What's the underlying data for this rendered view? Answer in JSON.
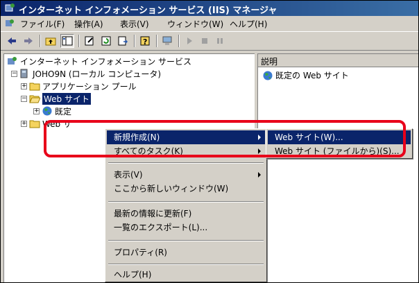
{
  "window": {
    "title": "インターネット インフォメーション サービス (IIS) マネージャ"
  },
  "menu": [
    "ファイル(F)",
    "操作(A)",
    "表示(V)",
    "ウィンドウ(W)",
    "ヘルプ(H)"
  ],
  "toolbar": {
    "icons": [
      "back-arrow-icon",
      "forward-arrow-icon",
      "up-folder-icon",
      "show-hide-tree-icon",
      "properties-icon",
      "refresh-icon",
      "export-list-icon",
      "help-icon",
      "computer-icon",
      "play-icon",
      "stop-icon",
      "pause-icon"
    ]
  },
  "tree": {
    "root": "インターネット インフォメーション サービス",
    "computer": "JOHO9N (ローカル コンピュータ)",
    "app_pools": "アプリケーション プール",
    "web_sites": "Web サイト",
    "default_site": "既定",
    "web_service": "Web サ"
  },
  "right_pane": {
    "column_header": "説明",
    "items": [
      "既定の Web サイト"
    ]
  },
  "context_menu": {
    "items": [
      "新規作成(N)",
      "すべてのタスク(K)",
      "表示(V)",
      "ここから新しいウィンドウ(W)",
      "最新の情報に更新(F)",
      "一覧のエクスポート(L)...",
      "プロパティ(R)",
      "ヘルプ(H)"
    ]
  },
  "submenu": {
    "items": [
      "Web サイト(W)...",
      "Web サイト (ファイルから)(S)..."
    ]
  },
  "colors": {
    "accent": "#0a246a",
    "highlight": "#e8001a",
    "chrome": "#d4d0c8"
  }
}
